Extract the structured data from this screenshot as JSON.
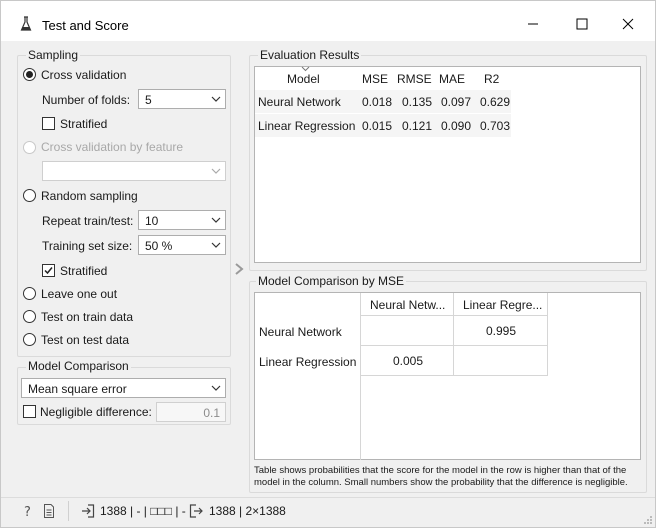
{
  "window": {
    "title": "Test and Score"
  },
  "sampling": {
    "group_title": "Sampling",
    "cross_validation": {
      "label": "Cross validation",
      "selected": true
    },
    "number_of_folds": {
      "label": "Number of folds:",
      "value": "5"
    },
    "stratified_cv": {
      "label": "Stratified",
      "checked": false
    },
    "cv_by_feature": {
      "label": "Cross validation by feature",
      "enabled": false,
      "value": ""
    },
    "random_sampling": {
      "label": "Random sampling",
      "selected": false
    },
    "repeat": {
      "label": "Repeat train/test:",
      "value": "10"
    },
    "training_size": {
      "label": "Training set size:",
      "value": "50 %"
    },
    "stratified_rs": {
      "label": "Stratified",
      "checked": true
    },
    "leave_one_out": {
      "label": "Leave one out"
    },
    "test_on_train": {
      "label": "Test on train data"
    },
    "test_on_test": {
      "label": "Test on test data"
    }
  },
  "model_comparison": {
    "group_title": "Model Comparison",
    "metric": "Mean square error",
    "negligible": {
      "label": "Negligible difference:",
      "checked": false,
      "value": "0.1"
    }
  },
  "evaluation": {
    "group_title": "Evaluation Results",
    "columns": [
      "Model",
      "MSE",
      "RMSE",
      "MAE",
      "R2"
    ],
    "rows": [
      {
        "model": "Neural Network",
        "mse": "0.018",
        "rmse": "0.135",
        "mae": "0.097",
        "r2": "0.629"
      },
      {
        "model": "Linear Regression",
        "mse": "0.015",
        "rmse": "0.121",
        "mae": "0.090",
        "r2": "0.703"
      }
    ]
  },
  "comparison": {
    "group_title": "Model Comparison by MSE",
    "col_headers": [
      "Neural Netw...",
      "Linear Regre..."
    ],
    "row_headers": [
      "Neural Network",
      "Linear Regression"
    ],
    "cells": [
      [
        "",
        "0.995"
      ],
      [
        "0.005",
        ""
      ]
    ],
    "note": "Table shows probabilities that the score for the model in the row is higher than that of the model in the column. Small numbers show the probability that the difference is negligible."
  },
  "status": {
    "input_summary": "1388 | - | □□□ | -",
    "output_summary": "1388 | 2×1388"
  }
}
